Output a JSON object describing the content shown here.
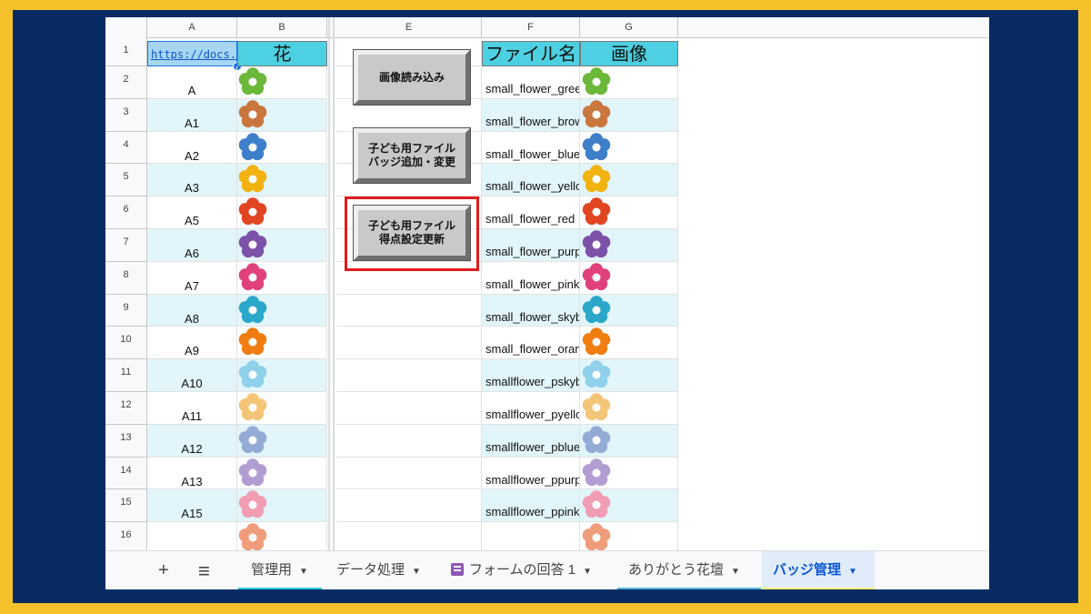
{
  "columns": [
    "A",
    "B",
    "E",
    "F",
    "G"
  ],
  "header_row": {
    "row_num": "1",
    "a_link": "https://docs.go",
    "b_title": "花",
    "f_title": "ファイル名",
    "g_title": "画像"
  },
  "rows": [
    {
      "num": "2",
      "label": "A",
      "file": "small_flower_green",
      "color": "#6bb83a"
    },
    {
      "num": "3",
      "label": "A1",
      "file": "small_flower_brown",
      "color": "#c9773f"
    },
    {
      "num": "4",
      "label": "A2",
      "file": "small_flower_blue",
      "color": "#3e7fc9"
    },
    {
      "num": "5",
      "label": "A3",
      "file": "small_flower_yellow",
      "color": "#f2b20f"
    },
    {
      "num": "6",
      "label": "A5",
      "file": "small_flower_red",
      "color": "#e24522"
    },
    {
      "num": "7",
      "label": "A6",
      "file": "small_flower_purple",
      "color": "#7b52a8"
    },
    {
      "num": "8",
      "label": "A7",
      "file": "small_flower_pink",
      "color": "#e0417c"
    },
    {
      "num": "9",
      "label": "A8",
      "file": "small_flower_skyblue",
      "color": "#2aa7c9"
    },
    {
      "num": "10",
      "label": "A9",
      "file": "small_flower_orange",
      "color": "#ef7d12"
    },
    {
      "num": "11",
      "label": "A10",
      "file": "smallflower_pskyblue",
      "color": "#8fd0eb"
    },
    {
      "num": "12",
      "label": "A11",
      "file": "smallflower_pyellow",
      "color": "#f5c577"
    },
    {
      "num": "13",
      "label": "A12",
      "file": "smallflower_pblue",
      "color": "#94abd6"
    },
    {
      "num": "14",
      "label": "A13",
      "file": "smallflower_ppurple",
      "color": "#b29dd2"
    },
    {
      "num": "15",
      "label": "A15",
      "file": "smallflower_ppink",
      "color": "#f19db3"
    },
    {
      "num": "16",
      "label": "",
      "file": "",
      "color": "#ef9c7b"
    }
  ],
  "buttons": {
    "load_images": "画像読み込み",
    "badge_update": "子ども用ファイル\nバッジ追加・変更",
    "score_update": "子ども用ファイル\n得点設定更新"
  },
  "tabs": {
    "add": "+",
    "menu": "≡",
    "t1": "管理用",
    "t2": "データ処理",
    "t3": "フォームの回答 1",
    "t4": "ありがとう花壇",
    "t5": "バッジ管理",
    "caret": "▼"
  },
  "colors": {
    "header_cyan": "#4dd0e1",
    "band": "#e1f5fa",
    "highlight_red": "#e11b1b",
    "tab1_underline": "#26c6da",
    "tab4_underline": "#4fb3d9",
    "tab5_underline": "#fff176"
  }
}
